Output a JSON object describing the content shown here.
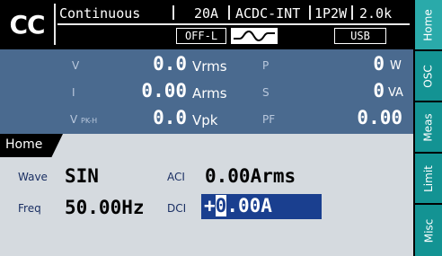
{
  "status": {
    "mode_badge": "CC",
    "output_mode": "Continuous",
    "current_range": "20A",
    "coupling": "ACDC-INT",
    "phase": "1P2W",
    "frequency_range": "2.0k",
    "limiter": "OFF-L",
    "waveform_icon": "sine-wave-icon",
    "interface": "USB"
  },
  "measurements": {
    "v_label": "V",
    "v_value": "0.0",
    "v_unit": "Vrms",
    "i_label": "I",
    "i_value": "0.00",
    "i_unit": "Arms",
    "vpk_label": "V",
    "vpk_sub": "PK-H",
    "vpk_value": "0.0",
    "vpk_unit": "Vpk",
    "p_label": "P",
    "p_value": "0",
    "p_unit": "W",
    "s_label": "S",
    "s_value": "0",
    "s_unit": "VA",
    "pf_label": "PF",
    "pf_value": "0.00"
  },
  "home": {
    "title": "Home",
    "wave_label": "Wave",
    "wave_value": "SIN",
    "freq_label": "Freq",
    "freq_value": "50.00Hz",
    "aci_label": "ACI",
    "aci_value": "0.00Arms",
    "dci_label": "DCI",
    "dci_sign": "+",
    "dci_cursor": "0",
    "dci_rest": ".00A"
  },
  "side_tabs": [
    {
      "label": "Home"
    },
    {
      "label": "OSC"
    },
    {
      "label": "Meas"
    },
    {
      "label": "Limit"
    },
    {
      "label": "Misc"
    }
  ],
  "colors": {
    "measurement_panel": "#4a6a8f",
    "settings_panel": "#d5dadf",
    "tab_active": "#2aaaaa",
    "tab_idle": "#139393",
    "edit_highlight": "#1a3f8f"
  }
}
